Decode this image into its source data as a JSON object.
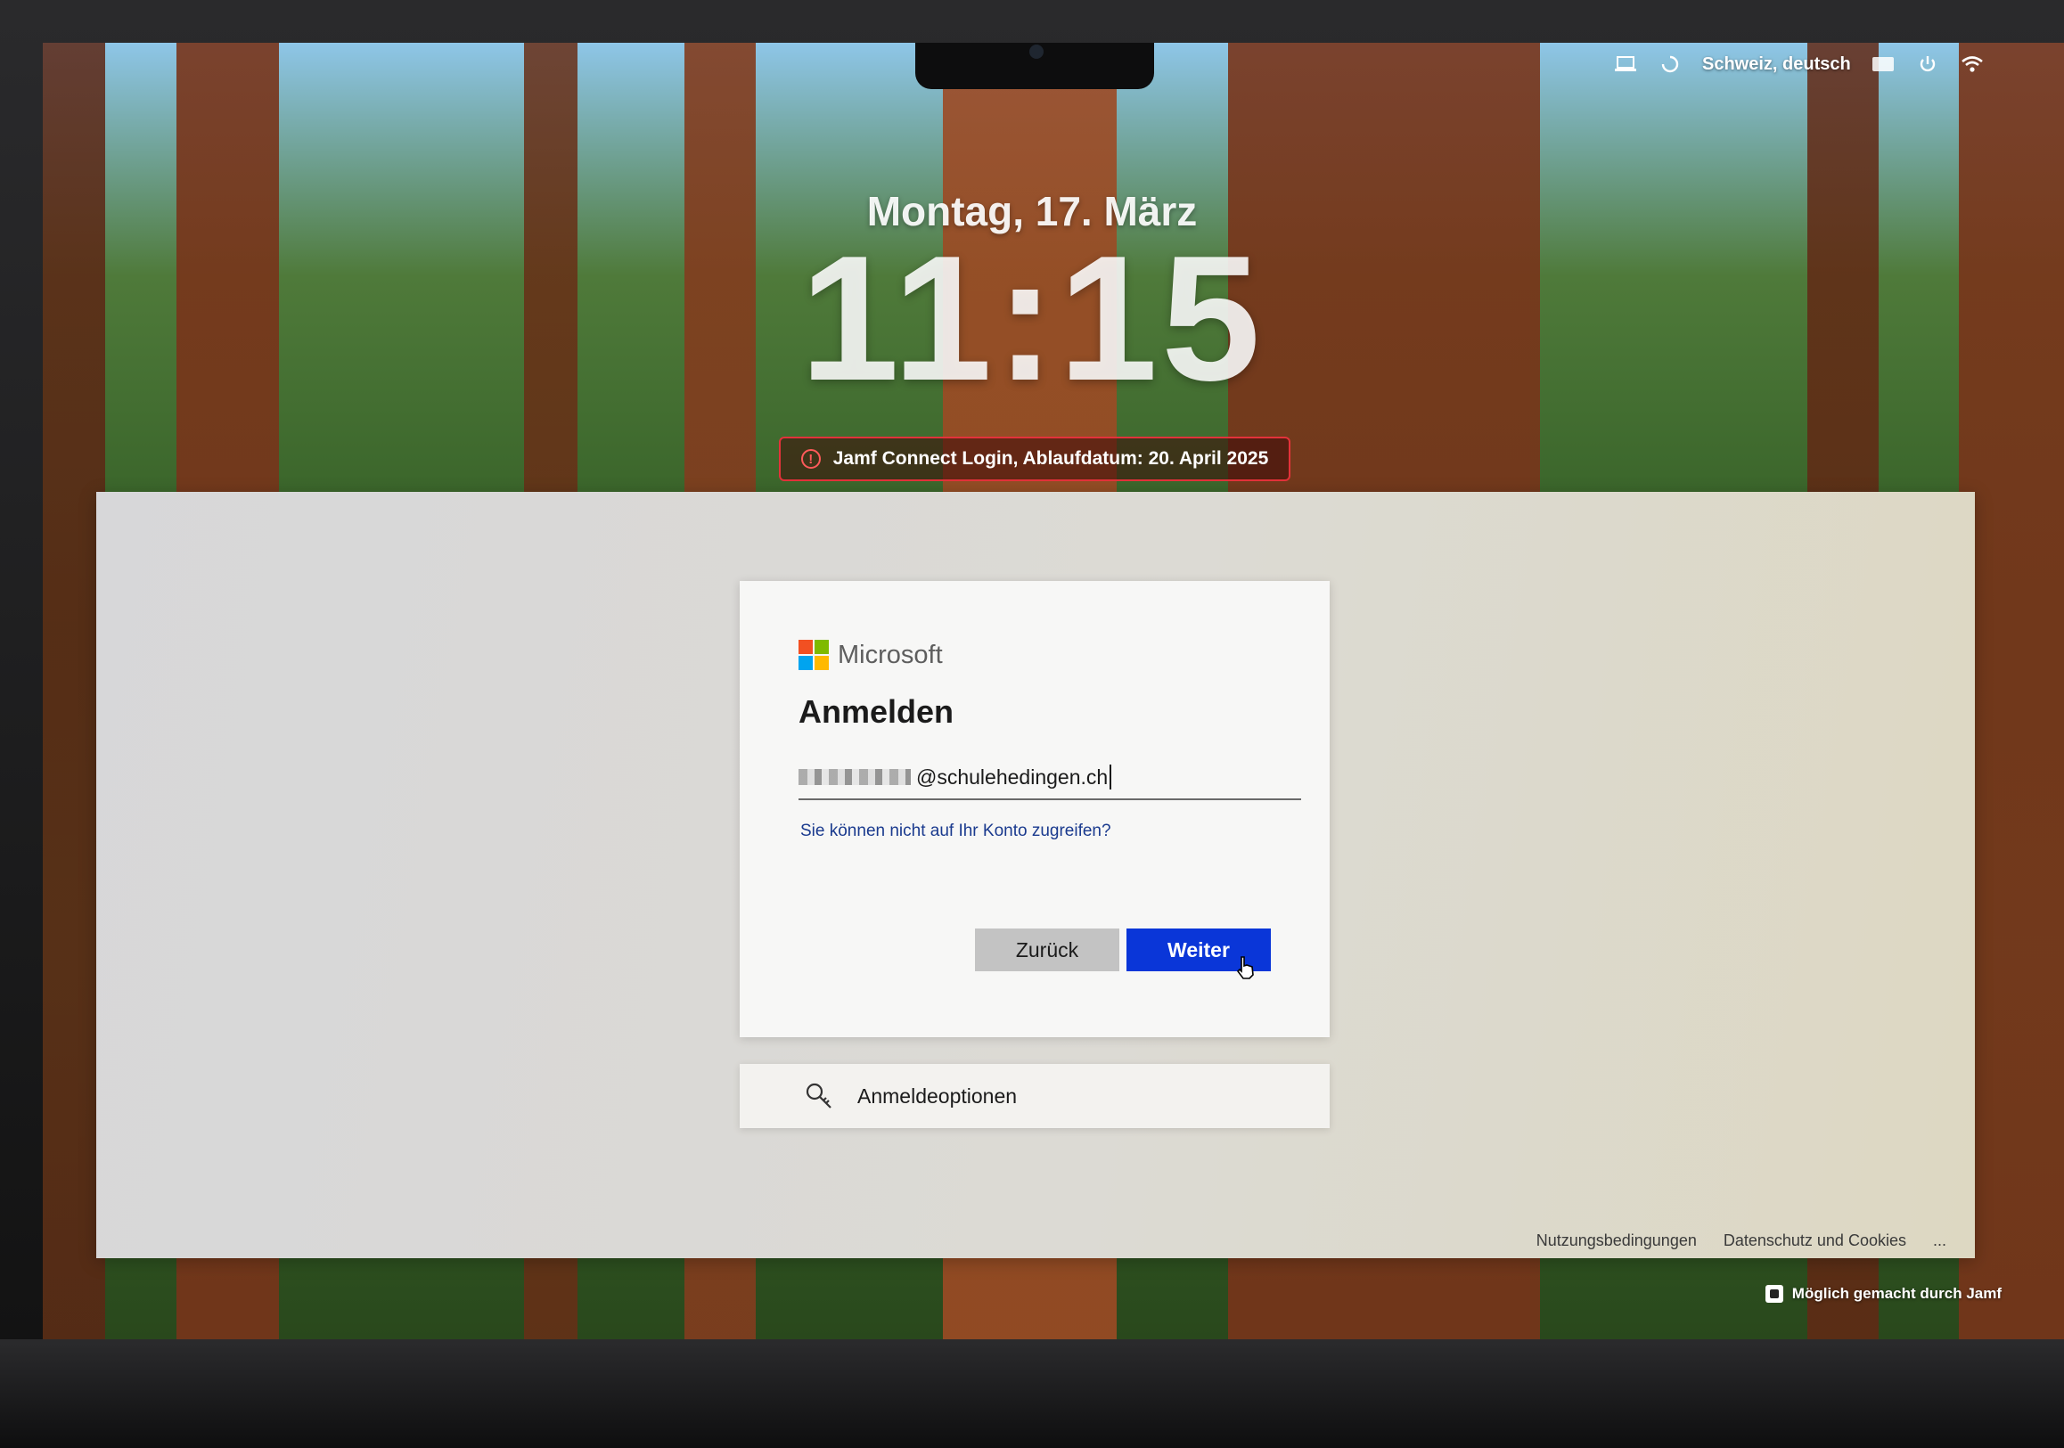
{
  "status_bar": {
    "keyboard_label": "Schweiz, deutsch",
    "icons": [
      "laptop-icon",
      "restart-icon",
      "keyboard-icon",
      "power-icon",
      "wifi-icon"
    ]
  },
  "lock_screen": {
    "date": "Montag, 17. März",
    "time": "11:15",
    "expiry_notice": "Jamf Connect Login, Ablaufdatum:  20. April 2025"
  },
  "login_card": {
    "brand": "Microsoft",
    "title": "Anmelden",
    "email_domain": "@schulehedingen.ch",
    "help_link": "Sie können nicht auf Ihr Konto zugreifen?",
    "back_button": "Zurück",
    "next_button": "Weiter"
  },
  "sign_in_options": {
    "label": "Anmeldeoptionen",
    "icon": "key-icon"
  },
  "footer": {
    "terms": "Nutzungsbedingungen",
    "privacy": "Datenschutz und Cookies",
    "more": "..."
  },
  "powered_by": "Möglich gemacht durch Jamf",
  "colors": {
    "accent_blue": "#0a36d8",
    "expiry_border": "#e3323a",
    "ms_red": "#f25022",
    "ms_green": "#7fba00",
    "ms_blue": "#00a4ef",
    "ms_yellow": "#ffb900"
  }
}
